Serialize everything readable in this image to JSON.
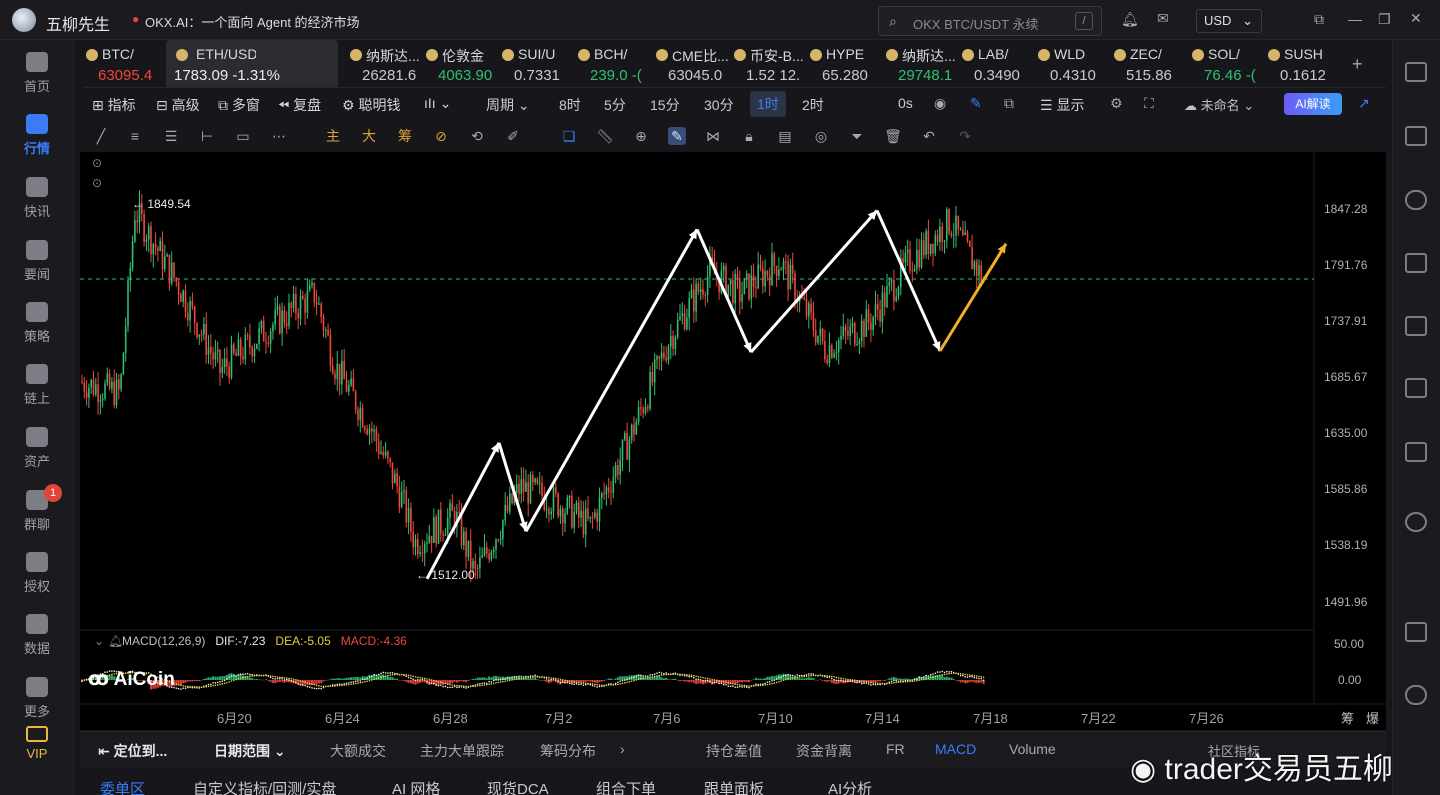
{
  "titlebar": {
    "username": "五柳先生",
    "news_ticker": "OKX.AI：一个面向 Agent 的经济市场",
    "search_placeholder": "OKX BTC/USDT 永续",
    "search_shortcut": "/",
    "currency": "USD"
  },
  "sidebar": {
    "items": [
      {
        "label": "首页"
      },
      {
        "label": "行情"
      },
      {
        "label": "快讯"
      },
      {
        "label": "要闻"
      },
      {
        "label": "策略"
      },
      {
        "label": "链上"
      },
      {
        "label": "资产"
      },
      {
        "label": "群聊",
        "badge": "1"
      },
      {
        "label": "授权"
      },
      {
        "label": "数据"
      },
      {
        "label": "更多"
      },
      {
        "label": "VIP"
      }
    ]
  },
  "tickers": [
    {
      "name": "BTC/",
      "price": "63095.4",
      "dir": "dn"
    },
    {
      "name": "ETH/USDT",
      "price": "1783.09  -1.31%",
      "dir": "dn"
    },
    {
      "name": "纳斯达...",
      "price": "26281.6",
      "dir": "neutral"
    },
    {
      "name": "伦敦金",
      "price": "4063.90",
      "dir": "up"
    },
    {
      "name": "SUI/U",
      "price": "0.7331",
      "dir": "neutral"
    },
    {
      "name": "BCH/",
      "price": "239.0 -(",
      "dir": "up"
    },
    {
      "name": "CME比...",
      "price": "63045.0",
      "dir": "neutral"
    },
    {
      "name": "币安-B...",
      "price": "1.52 12.",
      "dir": "neutral"
    },
    {
      "name": "HYPE",
      "price": "65.280",
      "dir": "neutral"
    },
    {
      "name": "纳斯达...",
      "price": "29748.1",
      "dir": "up"
    },
    {
      "name": "LAB/",
      "price": "0.3490",
      "dir": "neutral"
    },
    {
      "name": "WLD",
      "price": "0.4310",
      "dir": "neutral"
    },
    {
      "name": "ZEC/",
      "price": "515.86",
      "dir": "neutral"
    },
    {
      "name": "SOL/",
      "price": "76.46 -(",
      "dir": "up"
    },
    {
      "name": "SUSH",
      "price": "0.1612",
      "dir": "neutral"
    }
  ],
  "toolbar": {
    "indicator": "指标",
    "advanced": "高级",
    "multi_window": "多窗",
    "replay": "复盘",
    "smart_money": "聪明钱",
    "period": "周期",
    "periods": [
      "8时",
      "5分",
      "15分",
      "30分",
      "1时",
      "2时"
    ],
    "active_period": "1时",
    "countdown": "0s",
    "display": "显示",
    "layout_name": "未命名",
    "ai_read": "AI解读"
  },
  "drawing_tools": {
    "labels": [
      "主",
      "大",
      "筹"
    ]
  },
  "chart_data": {
    "type": "candlestick",
    "symbol": "ETH/USDT",
    "interval": "1H",
    "y_ticks": [
      "1847.28",
      "1791.76",
      "1737.91",
      "1685.67",
      "1635.00",
      "1585.86",
      "1538.19",
      "1491.96"
    ],
    "x_ticks": [
      "6月20",
      "6月24",
      "6月28",
      "7月2",
      "7月6",
      "7月10",
      "7月14",
      "7月18",
      "7月22",
      "7月26"
    ],
    "x_right_labels": [
      "筹",
      "爆"
    ],
    "high_label": "← 1849.54",
    "low_label": "← 1512.00",
    "last_price": 1783.09,
    "path_points": [
      {
        "date": "6月27",
        "price": 1512
      },
      {
        "date": "6月29 (late)",
        "price": 1635
      },
      {
        "date": "6月30 (late)",
        "price": 1555
      },
      {
        "date": "7月7",
        "price": 1828
      },
      {
        "date": "7月9",
        "price": 1717
      },
      {
        "date": "7月13 (late)",
        "price": 1845
      },
      {
        "date": "7月16",
        "price": 1718
      }
    ],
    "projection": {
      "from": {
        "date": "7月16",
        "price": 1718
      },
      "to": {
        "date": "7月18",
        "price": 1815
      },
      "color": "#f0b02a"
    },
    "macd": {
      "label": "MACD(12,26,9)",
      "dif": "DIF:-7.23",
      "dea": "DEA:-5.05",
      "macd": "MACD:-4.36",
      "y_ticks": [
        "50.00",
        "0.00"
      ]
    },
    "grid": false
  },
  "chart_brand": "AiCoin",
  "bottom_tabs": {
    "row1": [
      "定位到...",
      "日期范围",
      "大额成交",
      "主力大单跟踪",
      "筹码分布",
      "持仓差值",
      "资金背离",
      "FR",
      "MACD",
      "Volume",
      "社区指标"
    ],
    "active_row1": "MACD",
    "row2": [
      "委单区",
      "自定义指标/回测/实盘",
      "AI 网格",
      "现货DCA",
      "组合下单",
      "跟单面板",
      "AI分析"
    ],
    "active_row2": "委单区"
  },
  "watermark": "trader交易员五柳",
  "colors": {
    "up": "#2fbf71",
    "down": "#f0463c",
    "accent": "#3b7cf6",
    "projection": "#f0b02a"
  }
}
